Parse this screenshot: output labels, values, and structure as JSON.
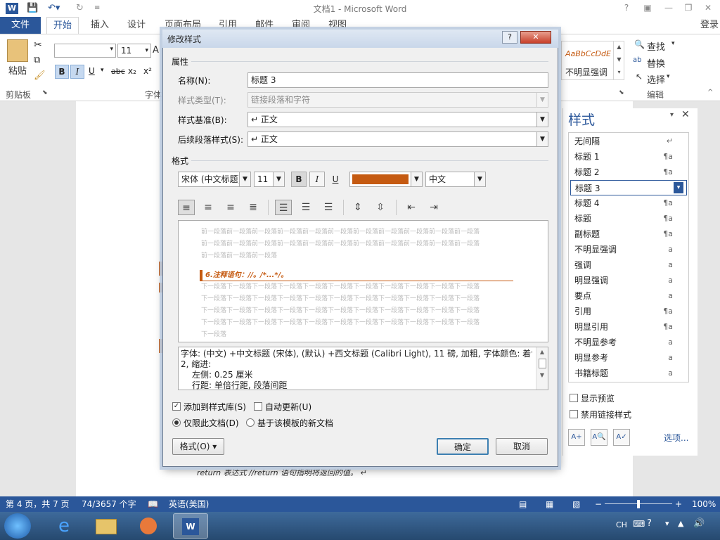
{
  "window": {
    "title": "文档1 - Microsoft Word",
    "help": "?"
  },
  "tabs": {
    "file": "文件",
    "home": "开始",
    "insert": "插入",
    "design": "设计",
    "layout": "页面布局",
    "references": "引用",
    "mailings": "邮件",
    "review": "审阅",
    "view": "视图",
    "login": "登录"
  },
  "ribbon": {
    "paste": "粘贴",
    "clipboard": "剪贴板",
    "font_size": "11",
    "font_group": "字体",
    "bold": "B",
    "italic": "I",
    "underline": "U",
    "strike": "abc",
    "sub": "x₂",
    "sup": "x²",
    "style_sample": "AaBbCcDdE",
    "style_sample_name": "不明显强调",
    "find": "查找",
    "replace": "替换",
    "select": "选择",
    "editing": "编辑"
  },
  "dialog": {
    "title": "修改样式",
    "help": "?",
    "props_section": "属性",
    "name_label": "名称(N):",
    "name_value": "标题 3",
    "type_label": "样式类型(T):",
    "type_value": "链接段落和字符",
    "based_label": "样式基准(B):",
    "based_value": "↵ 正文",
    "next_label": "后续段落样式(S):",
    "next_value": "↵ 正文",
    "format_section": "格式",
    "font_value": "宋体 (中文标题)",
    "size_value": "11",
    "bold": "B",
    "italic": "I",
    "underline": "U",
    "font_color": "#c55a11",
    "lang_value": "中文",
    "preview_before": [
      "前一段落前一段落前一段落前一段落前一段落前一段落前一段落前一段落前一段落前一段落前一段落",
      "前一段落前一段落前一段落前一段落前一段落前一段落前一段落前一段落前一段落前一段落前一段落",
      "前一段落前一段落前一段落"
    ],
    "preview_sample": "6.注释语句：//。/*...*/。",
    "preview_after": [
      "下一段落下一段落下一段落下一段落下一段落下一段落下一段落下一段落下一段落下一段落下一段落",
      "下一段落下一段落下一段落下一段落下一段落下一段落下一段落下一段落下一段落下一段落下一段落",
      "下一段落下一段落下一段落下一段落下一段落下一段落下一段落下一段落下一段落下一段落下一段落",
      "下一段落下一段落下一段落下一段落下一段落下一段落下一段落下一段落下一段落下一段落下一段落",
      "下一段落"
    ],
    "desc_line1": "字体: (中文) +中文标题 (宋体), (默认) +西文标题 (Calibri Light), 11 磅, 加粗, 字体颜色: 着色",
    "desc_line2": "2, 缩进:",
    "desc_line3": "左侧:  0.25 厘米",
    "desc_line4": "行距: 单倍行距, 段落间距",
    "add_to_gallery": "添加到样式库(S)",
    "auto_update": "自动更新(U)",
    "only_doc": "仅限此文档(D)",
    "new_docs": "基于该模板的新文档",
    "format_btn": "格式(O) ▾",
    "ok": "确定",
    "cancel": "取消"
  },
  "styles_pane": {
    "title": "样式",
    "items": [
      {
        "name": "无间隔",
        "mark": "↵"
      },
      {
        "name": "标题 1",
        "mark": "¶a"
      },
      {
        "name": "标题 2",
        "mark": "¶a"
      },
      {
        "name": "标题 3",
        "mark": "▾"
      },
      {
        "name": "标题 4",
        "mark": "¶a"
      },
      {
        "name": "标题",
        "mark": "¶a"
      },
      {
        "name": "副标题",
        "mark": "¶a"
      },
      {
        "name": "不明显强调",
        "mark": "a"
      },
      {
        "name": "强调",
        "mark": "a"
      },
      {
        "name": "明显强调",
        "mark": "a"
      },
      {
        "name": "要点",
        "mark": "a"
      },
      {
        "name": "引用",
        "mark": "¶a"
      },
      {
        "name": "明显引用",
        "mark": "¶a"
      },
      {
        "name": "不明显参考",
        "mark": "a"
      },
      {
        "name": "明显参考",
        "mark": "a"
      },
      {
        "name": "书籍标题",
        "mark": "a"
      }
    ],
    "show_preview": "显示预览",
    "disable_linked": "禁用链接样式",
    "options": "选项..."
  },
  "document": {
    "bottom_line": "return  表达式 //return 语句指明将返回的值。 ↵"
  },
  "statusbar": {
    "page": "第 4 页，共 7 页",
    "words": "74/3657 个字",
    "lang": "英语(美国)",
    "zoom": "100%",
    "zoom_level": 0.5
  },
  "taskbar": {
    "ime": "CH"
  }
}
